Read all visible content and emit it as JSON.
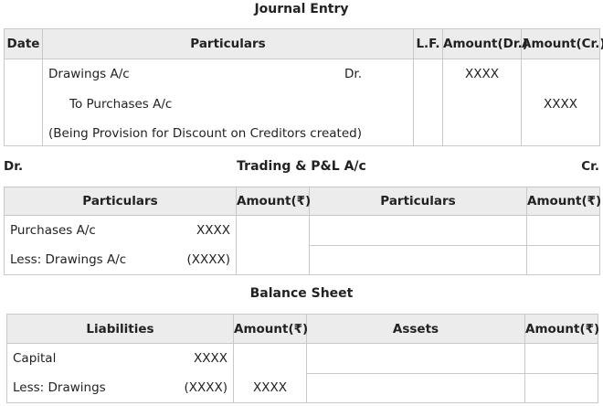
{
  "journal": {
    "title": "Journal Entry",
    "headers": [
      "Date",
      "Particulars",
      "L.F.",
      "Amount(Dr.)",
      "Amount(Cr.)"
    ],
    "line1_account": "Drawings A/c",
    "line1_dr": "Dr.",
    "line1_amount_dr": "XXXX",
    "line2_account": "To Purchases A/c",
    "line2_amount_cr": "XXXX",
    "narration": "(Being Provision for Discount on Creditors created)"
  },
  "trading": {
    "left_label": "Dr.",
    "title": "Trading & P&L A/c",
    "right_label": "Cr.",
    "headers": [
      "Particulars",
      "Amount(₹)",
      "Particulars",
      "Amount(₹)"
    ],
    "rows": [
      {
        "particular": "Purchases A/c",
        "value": "XXXX"
      },
      {
        "particular": "Less: Drawings A/c",
        "value": "(XXXX)"
      }
    ]
  },
  "balance_sheet": {
    "title": "Balance Sheet",
    "headers": [
      "Liabilities",
      "Amount(₹)",
      "Assets",
      "Amount(₹)"
    ],
    "rows": [
      {
        "particular": "Capital",
        "value": "XXXX",
        "amount": ""
      },
      {
        "particular": "Less: Drawings",
        "value": "(XXXX)",
        "amount": "XXXX"
      }
    ]
  }
}
